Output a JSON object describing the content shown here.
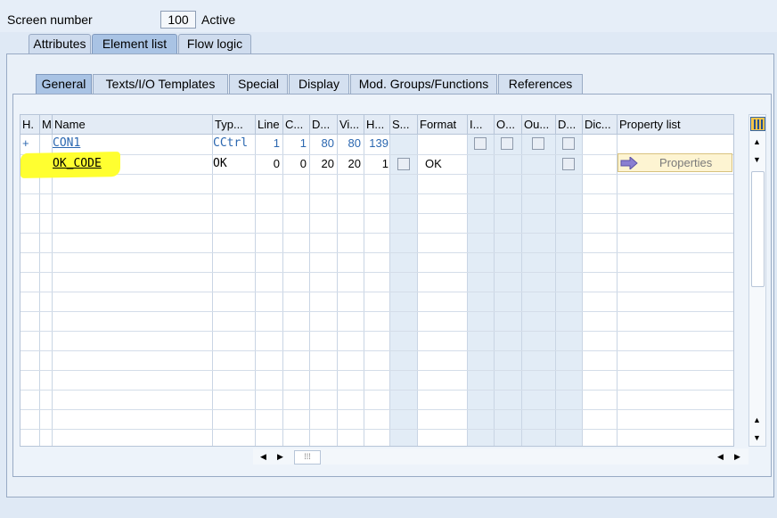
{
  "header": {
    "screen_number_label": "Screen number",
    "screen_number_value": "100",
    "status": "Active"
  },
  "outer_tabs": [
    {
      "label": "Attributes"
    },
    {
      "label": "Element list",
      "active": true
    },
    {
      "label": "Flow logic"
    }
  ],
  "inner_tabs": [
    {
      "label": "General",
      "active": true
    },
    {
      "label": "Texts/I/O Templates"
    },
    {
      "label": "Special"
    },
    {
      "label": "Display"
    },
    {
      "label": "Mod. Groups/Functions"
    },
    {
      "label": "References"
    }
  ],
  "table": {
    "columns": [
      "H.",
      "M",
      "Name",
      "Typ...",
      "Line",
      "C...",
      "D...",
      "Vi...",
      "H...",
      "S...",
      "Format",
      "I...",
      "O...",
      "Ou...",
      "D...",
      "Dic...",
      "Property list"
    ],
    "rows": [
      {
        "h": "+",
        "name": "CON1",
        "type": "CCtrl",
        "line": "1",
        "col": "1",
        "def_len": "80",
        "vis_len": "80",
        "height": "139"
      },
      {
        "h": "",
        "name": "OK_CODE",
        "type": "OK",
        "line": "0",
        "col": "0",
        "def_len": "20",
        "vis_len": "20",
        "height": "1",
        "format": "OK",
        "property_button": "Properties"
      }
    ]
  },
  "colors": {
    "highlight": "#ffff30",
    "link_blue": "#2b67b0",
    "tab_active": "#a9c3e4"
  },
  "icons": {
    "table_settings": "table-settings-icon",
    "property_arrow": "arrow-right-icon"
  }
}
